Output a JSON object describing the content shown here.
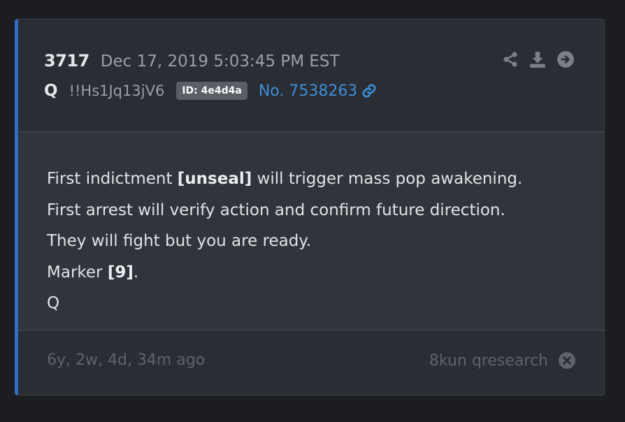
{
  "post": {
    "number": "3717",
    "date": "Dec 17, 2019 5:03:45 PM EST",
    "author": "Q",
    "tripcode": "!!Hs1Jq13jV6",
    "id_badge": "ID: 4e4d4a",
    "post_link": "No. 7538263"
  },
  "actions": {
    "icons": [
      "share-icon",
      "download-icon",
      "arrow-circle-right-icon"
    ]
  },
  "body": {
    "lines": [
      {
        "before": "First indictment ",
        "bold": "[unseal]",
        "after": " will trigger mass pop awakening."
      },
      {
        "text": "First arrest will verify action and confirm future direction."
      },
      {
        "text": "They will fight but you are ready."
      },
      {
        "before": "Marker ",
        "bold": "[9]",
        "after": "."
      },
      {
        "text": "Q"
      }
    ]
  },
  "footer": {
    "time_ago": "6y, 2w, 4d, 34m ago",
    "source": "8kun qresearch",
    "source_icon": "close-circle-icon"
  },
  "colors": {
    "accent": "#2d6fc2",
    "link": "#3d8edb",
    "badge": "#5a5e65"
  }
}
